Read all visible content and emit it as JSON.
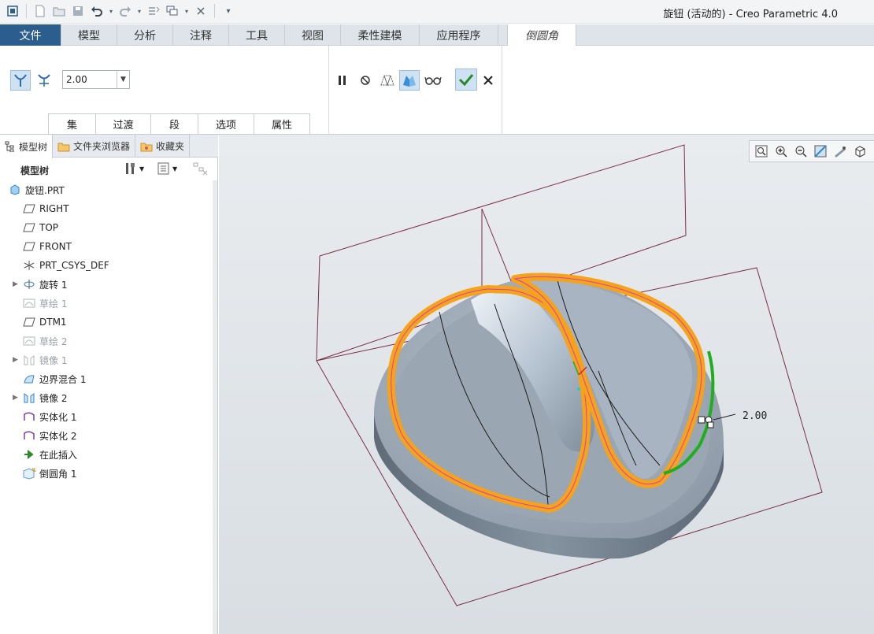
{
  "app": {
    "title": "旋钮 (活动的) - Creo Parametric 4.0"
  },
  "menu": {
    "tabs": [
      {
        "label": "文件"
      },
      {
        "label": "模型"
      },
      {
        "label": "分析"
      },
      {
        "label": "注释"
      },
      {
        "label": "工具"
      },
      {
        "label": "视图"
      },
      {
        "label": "柔性建模"
      },
      {
        "label": "应用程序"
      },
      {
        "label": "倒圆角"
      }
    ]
  },
  "ribbon": {
    "radius_value": "2.00",
    "panel_tabs": [
      {
        "label": "集"
      },
      {
        "label": "过渡"
      },
      {
        "label": "段"
      },
      {
        "label": "选项"
      },
      {
        "label": "属性"
      }
    ]
  },
  "left_panel": {
    "nav_tabs": [
      {
        "label": "模型树"
      },
      {
        "label": "文件夹浏览器"
      },
      {
        "label": "收藏夹"
      }
    ],
    "tree_title": "模型树",
    "tree_items": [
      {
        "label": "旋钮.PRT",
        "icon": "part-icon"
      },
      {
        "label": "RIGHT",
        "icon": "datum-plane-icon"
      },
      {
        "label": "TOP",
        "icon": "datum-plane-icon"
      },
      {
        "label": "FRONT",
        "icon": "datum-plane-icon"
      },
      {
        "label": "PRT_CSYS_DEF",
        "icon": "csys-icon"
      },
      {
        "label": "旋转 1",
        "icon": "revolve-icon"
      },
      {
        "label": "草绘 1",
        "icon": "sketch-icon"
      },
      {
        "label": "DTM1",
        "icon": "datum-plane-icon"
      },
      {
        "label": "草绘 2",
        "icon": "sketch-icon"
      },
      {
        "label": "镜像 1",
        "icon": "mirror-icon"
      },
      {
        "label": "边界混合 1",
        "icon": "boundary-blend-icon"
      },
      {
        "label": "镜像 2",
        "icon": "mirror-icon"
      },
      {
        "label": "实体化 1",
        "icon": "solidify-icon"
      },
      {
        "label": "实体化 2",
        "icon": "solidify-icon"
      },
      {
        "label": "在此插入",
        "icon": "insert-here-icon"
      },
      {
        "label": "倒圆角 1",
        "icon": "round-icon"
      }
    ]
  },
  "viewport": {
    "dimension_label": "2.00"
  },
  "colors": {
    "accent": "#2b5d8e",
    "round_highlight": "#f6a319",
    "selected_chain": "#1fae1f"
  }
}
